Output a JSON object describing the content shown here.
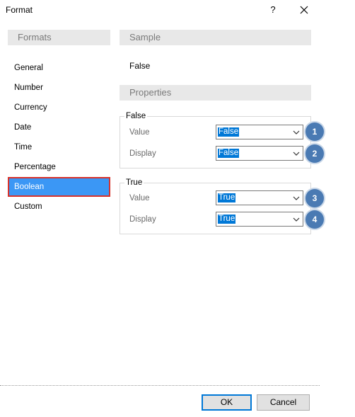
{
  "window": {
    "title": "Format",
    "help_label": "?"
  },
  "formats": {
    "header": "Formats",
    "items": [
      "General",
      "Number",
      "Currency",
      "Date",
      "Time",
      "Percentage",
      "Boolean",
      "Custom"
    ],
    "selected": "Boolean"
  },
  "sample": {
    "header": "Sample",
    "value": "False"
  },
  "properties": {
    "header": "Properties",
    "false_group": {
      "label": "False",
      "value_label": "Value",
      "value": "False",
      "value_badge": "1",
      "display_label": "Display",
      "display": "False",
      "display_badge": "2"
    },
    "true_group": {
      "label": "True",
      "value_label": "Value",
      "value": "True",
      "value_badge": "3",
      "display_label": "Display",
      "display": "True",
      "display_badge": "4"
    }
  },
  "buttons": {
    "ok": "OK",
    "cancel": "Cancel"
  },
  "colors": {
    "selection": "#3b97f5",
    "selection_border": "#d8322b",
    "badge": "#4a7ab3",
    "header_bg": "#e8e8e8"
  }
}
